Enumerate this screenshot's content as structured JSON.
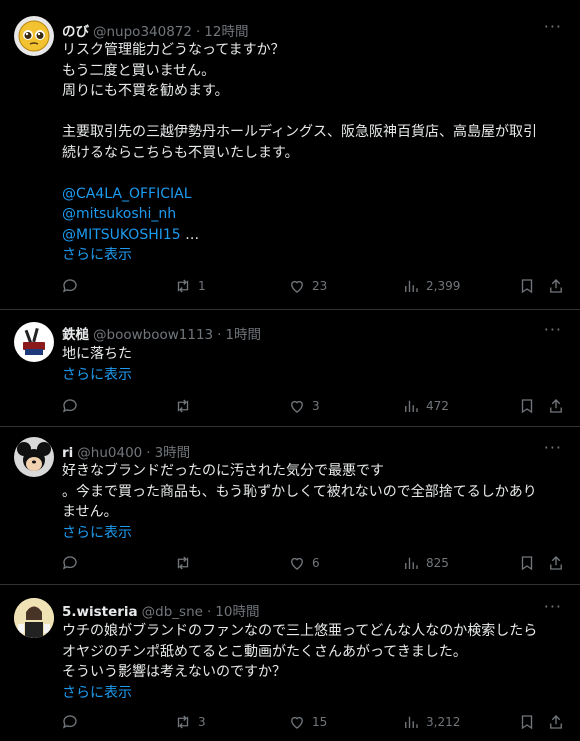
{
  "posts": [
    {
      "name": "のび",
      "handle": "@nupo340872",
      "time": "12時間",
      "lines": [
        "リスク管理能力どうなってますか？",
        "もう二度と買いません。",
        "周りにも不買を勧めます。",
        "",
        "主要取引先の三越伊勢丹ホールディングス、阪急阪神百貨店、高島屋が取引",
        "続けるならこちらも不買いたします。",
        ""
      ],
      "links": [
        "@CA4LA_OFFICIAL",
        "@mitsukoshi_nh",
        "@MITSUKOSHI15"
      ],
      "ellipsis": " …",
      "show_more": "さらに表示",
      "replies": "",
      "reposts": "1",
      "likes": "23",
      "views": "2,399"
    },
    {
      "name": "鉄槌",
      "handle": "@boowboow1113",
      "time": "1時間",
      "lines": [
        "地に落ちた"
      ],
      "show_more": "さらに表示",
      "replies": "",
      "reposts": "",
      "likes": "3",
      "views": "472"
    },
    {
      "name": "ri",
      "handle": "@hu0400",
      "time": "3時間",
      "lines": [
        "好きなブランドだったのに汚された気分で最悪です",
        "。今まで買った商品も、もう恥ずかしくて被れないので全部捨てるしかあり",
        "ません。"
      ],
      "show_more": "さらに表示",
      "replies": "",
      "reposts": "",
      "likes": "6",
      "views": "825"
    },
    {
      "name": "5.wisteria",
      "handle": "@db_sne",
      "time": "10時間",
      "lines": [
        "ウチの娘がブランドのファンなので三上悠亜ってどんな人なのか検索したら",
        "オヤジのチンポ舐めてるとこ動画がたくさんあがってきました。",
        "そういう影響は考えないのですか？"
      ],
      "show_more": "さらに表示",
      "replies": "",
      "reposts": "3",
      "likes": "15",
      "views": "3,212"
    }
  ],
  "separator": "·",
  "more_glyph": "···",
  "colors": {
    "background": "#000000",
    "text": "#e7e9ea",
    "muted": "#71767b",
    "link": "#1d9bf0",
    "divider": "#2f3336"
  }
}
